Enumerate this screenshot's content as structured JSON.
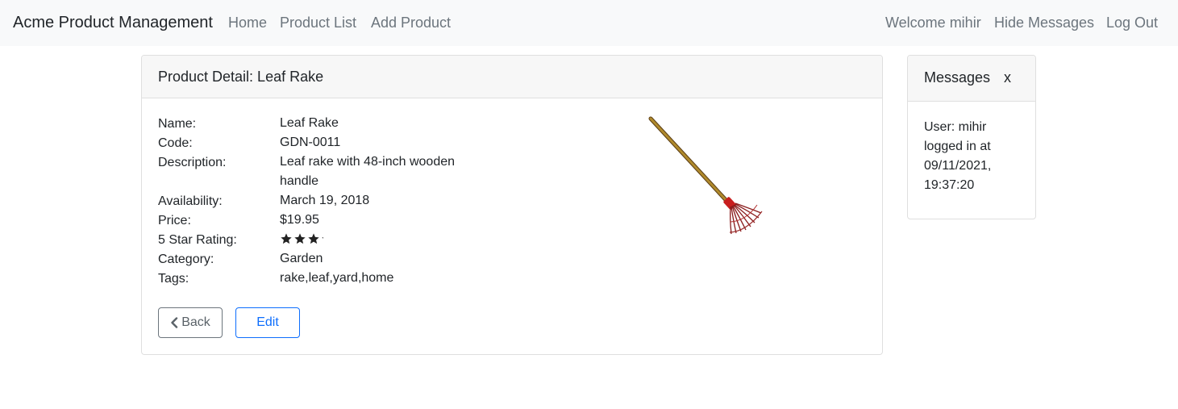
{
  "navbar": {
    "brand": "Acme Product Management",
    "links": [
      "Home",
      "Product List",
      "Add Product"
    ],
    "right_links": [
      "Welcome mihir",
      "Hide Messages",
      "Log Out"
    ]
  },
  "product": {
    "header": "Product Detail: Leaf Rake",
    "labels": {
      "name": "Name:",
      "code": "Code:",
      "description": "Description:",
      "availability": "Availability:",
      "price": "Price:",
      "rating": "5 Star Rating:",
      "category": "Category:",
      "tags": "Tags:"
    },
    "values": {
      "name": "Leaf Rake",
      "code": "GDN-0011",
      "description": "Leaf rake with 48-inch wooden handle",
      "availability": "March 19, 2018",
      "price": "$19.95",
      "rating": 3.2,
      "category": "Garden",
      "tags": "rake,leaf,yard,home"
    },
    "image_icon": "leaf-rake",
    "buttons": {
      "back": "Back",
      "edit": "Edit"
    }
  },
  "messages": {
    "title": "Messages",
    "close": "x",
    "body": "User: mihir logged in at 09/11/2021, 19:37:20"
  },
  "colors": {
    "navbar_bg": "#f8f9fa",
    "nav_link": "#6c757d",
    "primary": "#0d6efd",
    "secondary": "#6c757d",
    "card_header_bg": "#f7f7f7"
  }
}
